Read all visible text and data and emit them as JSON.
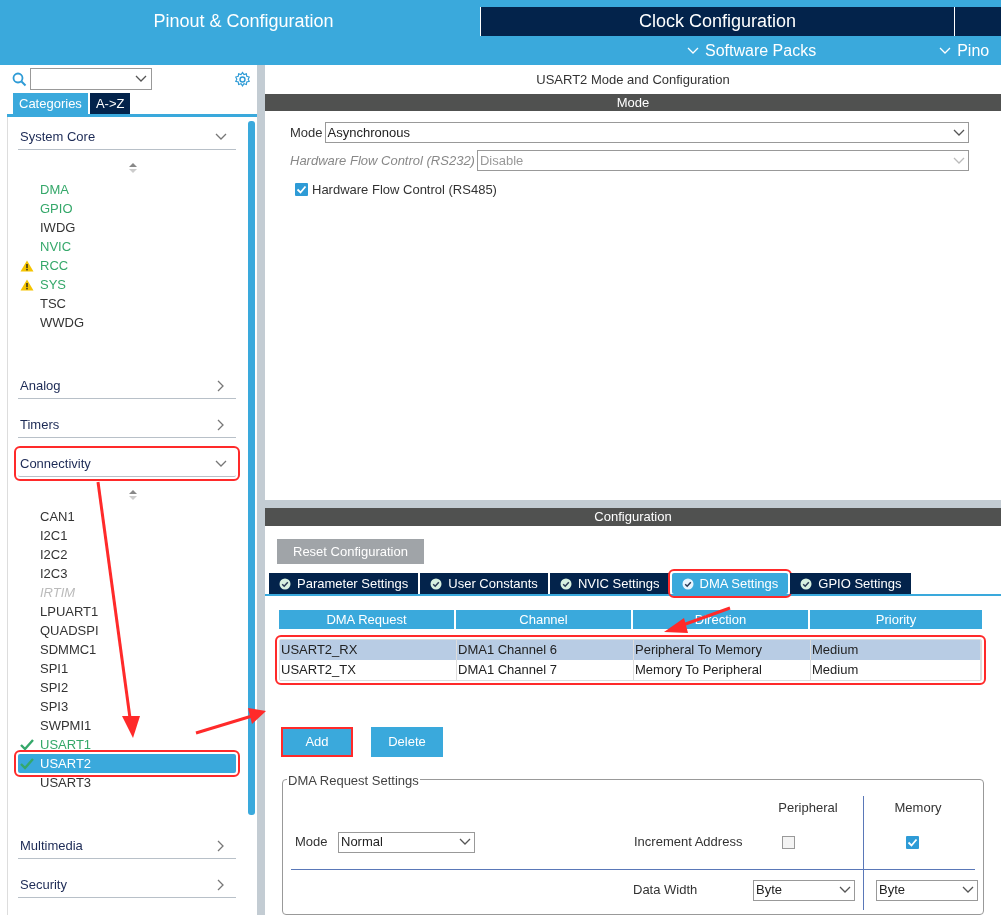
{
  "top_tabs": [
    {
      "label": "Pinout & Configuration",
      "selected": true
    },
    {
      "label": "Clock Configuration",
      "selected": false
    }
  ],
  "sub_menu": [
    {
      "label": "Software Packs"
    },
    {
      "label": "Pino"
    }
  ],
  "sidebar": {
    "view_tabs": [
      {
        "label": "Categories",
        "selected": true
      },
      {
        "label": "A->Z",
        "selected": false
      }
    ],
    "categories": [
      {
        "label": "System Core",
        "expanded": true,
        "highlighted": false,
        "items": [
          {
            "label": "DMA",
            "kind": "configured",
            "selected": false,
            "highlighted": false
          },
          {
            "label": "GPIO",
            "kind": "configured",
            "selected": false,
            "highlighted": false
          },
          {
            "label": "IWDG",
            "kind": "plain",
            "selected": false,
            "highlighted": false
          },
          {
            "label": "NVIC",
            "kind": "configured",
            "selected": false,
            "highlighted": false
          },
          {
            "label": "RCC",
            "kind": "warning",
            "selected": false,
            "highlighted": false
          },
          {
            "label": "SYS",
            "kind": "warning",
            "selected": false,
            "highlighted": false
          },
          {
            "label": "TSC",
            "kind": "plain",
            "selected": false,
            "highlighted": false
          },
          {
            "label": "WWDG",
            "kind": "plain",
            "selected": false,
            "highlighted": false
          }
        ]
      },
      {
        "label": "Analog",
        "expanded": false,
        "highlighted": false
      },
      {
        "label": "Timers",
        "expanded": false,
        "highlighted": false
      },
      {
        "label": "Connectivity",
        "expanded": true,
        "highlighted": true,
        "items": [
          {
            "label": "CAN1",
            "kind": "plain",
            "selected": false,
            "highlighted": false
          },
          {
            "label": "I2C1",
            "kind": "plain",
            "selected": false,
            "highlighted": false
          },
          {
            "label": "I2C2",
            "kind": "plain",
            "selected": false,
            "highlighted": false
          },
          {
            "label": "I2C3",
            "kind": "plain",
            "selected": false,
            "highlighted": false
          },
          {
            "label": "IRTIM",
            "kind": "disabled",
            "selected": false,
            "highlighted": false
          },
          {
            "label": "LPUART1",
            "kind": "plain",
            "selected": false,
            "highlighted": false
          },
          {
            "label": "QUADSPI",
            "kind": "plain",
            "selected": false,
            "highlighted": false
          },
          {
            "label": "SDMMC1",
            "kind": "plain",
            "selected": false,
            "highlighted": false
          },
          {
            "label": "SPI1",
            "kind": "plain",
            "selected": false,
            "highlighted": false
          },
          {
            "label": "SPI2",
            "kind": "plain",
            "selected": false,
            "highlighted": false
          },
          {
            "label": "SPI3",
            "kind": "plain",
            "selected": false,
            "highlighted": false
          },
          {
            "label": "SWPMI1",
            "kind": "plain",
            "selected": false,
            "highlighted": false
          },
          {
            "label": "USART1",
            "kind": "active",
            "selected": false,
            "highlighted": false
          },
          {
            "label": "USART2",
            "kind": "active",
            "selected": true,
            "highlighted": true
          },
          {
            "label": "USART3",
            "kind": "plain",
            "selected": false,
            "highlighted": false
          }
        ]
      },
      {
        "label": "Multimedia",
        "expanded": false,
        "highlighted": false
      },
      {
        "label": "Security",
        "expanded": false,
        "highlighted": false
      }
    ]
  },
  "mode_panel": {
    "title": "USART2 Mode and Configuration",
    "header": "Mode",
    "fields": [
      {
        "label": "Mode",
        "value": "Asynchronous",
        "disabled": false
      },
      {
        "label": "Hardware Flow Control (RS232)",
        "value": "Disable",
        "disabled": true
      }
    ],
    "checkbox": {
      "label": "Hardware Flow Control (RS485)",
      "checked": true
    }
  },
  "config_panel": {
    "header": "Configuration",
    "reset_button": "Reset Configuration",
    "tabs": [
      {
        "label": "Parameter Settings",
        "selected": false,
        "highlighted": false
      },
      {
        "label": "User Constants",
        "selected": false,
        "highlighted": false
      },
      {
        "label": "NVIC Settings",
        "selected": false,
        "highlighted": false
      },
      {
        "label": "DMA Settings",
        "selected": true,
        "highlighted": true
      },
      {
        "label": "GPIO Settings",
        "selected": false,
        "highlighted": false
      }
    ],
    "table": {
      "highlighted": true,
      "columns": [
        "DMA Request",
        "Channel",
        "Direction",
        "Priority"
      ],
      "rows": [
        {
          "cells": [
            "USART2_RX",
            "DMA1 Channel 6",
            "Peripheral To Memory",
            "Medium"
          ],
          "selected": true
        },
        {
          "cells": [
            "USART2_TX",
            "DMA1 Channel 7",
            "Memory To Peripheral",
            "Medium"
          ],
          "selected": false
        }
      ]
    },
    "buttons": [
      {
        "label": "Add",
        "highlighted": true
      },
      {
        "label": "Delete",
        "highlighted": false
      }
    ],
    "request_settings": {
      "legend": "DMA Request Settings",
      "mode_label": "Mode",
      "mode_value": "Normal",
      "col_peripheral": "Peripheral",
      "col_memory": "Memory",
      "increment_label": "Increment Address",
      "increment_peripheral": false,
      "increment_memory": true,
      "width_label": "Data Width",
      "width_peripheral": "Byte",
      "width_memory": "Byte"
    }
  }
}
